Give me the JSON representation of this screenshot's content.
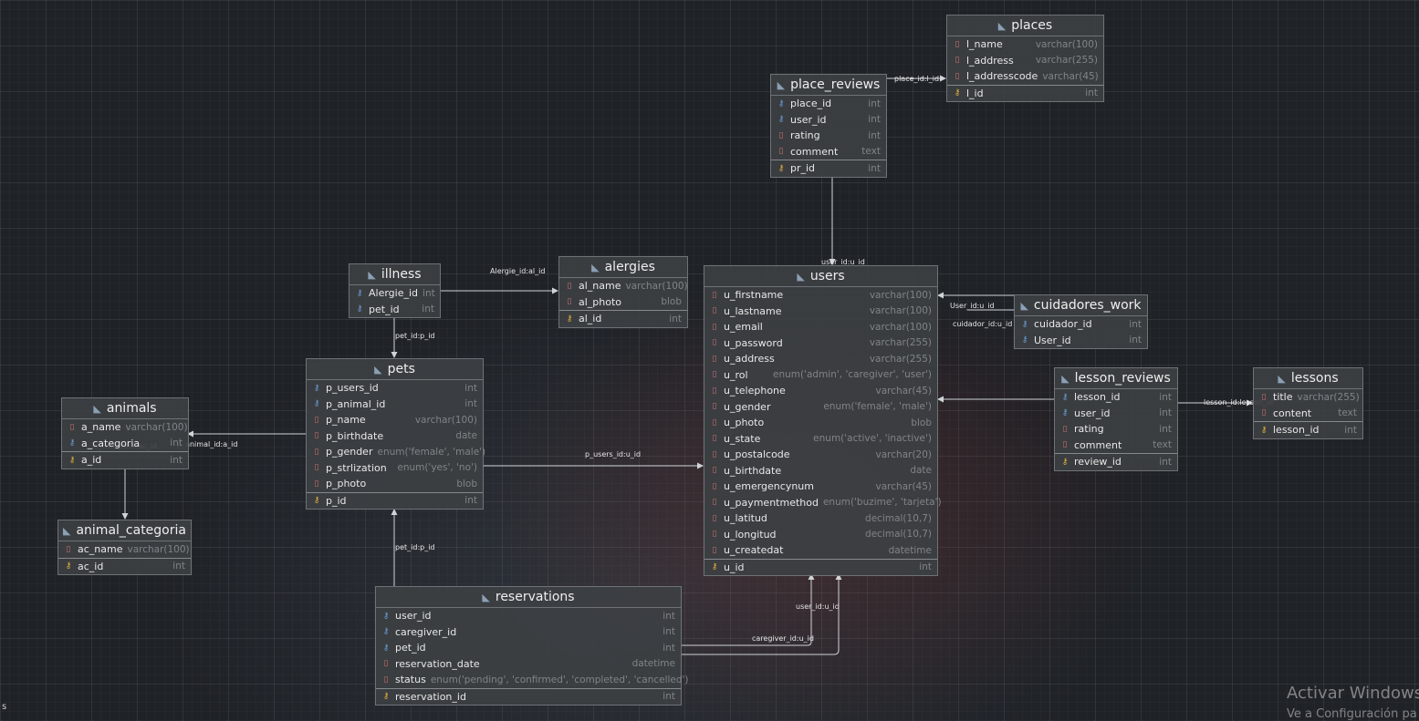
{
  "tables": {
    "places": {
      "name": "places",
      "columns": [
        {
          "name": "l_name",
          "type": "varchar(100)",
          "kind": "field"
        },
        {
          "name": "l_address",
          "type": "varchar(255)",
          "kind": "field"
        },
        {
          "name": "l_addresscode",
          "type": "varchar(45)",
          "kind": "field"
        },
        {
          "name": "l_id",
          "type": "int",
          "kind": "key"
        }
      ]
    },
    "place_reviews": {
      "name": "place_reviews",
      "columns": [
        {
          "name": "place_id",
          "type": "int",
          "kind": "fk"
        },
        {
          "name": "user_id",
          "type": "int",
          "kind": "fk"
        },
        {
          "name": "rating",
          "type": "int",
          "kind": "field"
        },
        {
          "name": "comment",
          "type": "text",
          "kind": "field"
        },
        {
          "name": "pr_id",
          "type": "int",
          "kind": "key"
        }
      ]
    },
    "illness": {
      "name": "illness",
      "columns": [
        {
          "name": "Alergie_id",
          "type": "int",
          "kind": "fk"
        },
        {
          "name": "pet_id",
          "type": "int",
          "kind": "fk"
        }
      ]
    },
    "alergies": {
      "name": "alergies",
      "columns": [
        {
          "name": "al_name",
          "type": "varchar(100)",
          "kind": "field"
        },
        {
          "name": "al_photo",
          "type": "blob",
          "kind": "field"
        },
        {
          "name": "al_id",
          "type": "int",
          "kind": "key"
        }
      ]
    },
    "users": {
      "name": "users",
      "columns": [
        {
          "name": "u_firstname",
          "type": "varchar(100)",
          "kind": "field"
        },
        {
          "name": "u_lastname",
          "type": "varchar(100)",
          "kind": "field"
        },
        {
          "name": "u_email",
          "type": "varchar(100)",
          "kind": "field"
        },
        {
          "name": "u_password",
          "type": "varchar(255)",
          "kind": "field"
        },
        {
          "name": "u_address",
          "type": "varchar(255)",
          "kind": "field"
        },
        {
          "name": "u_rol",
          "type": "enum('admin', 'caregiver', 'user')",
          "kind": "field"
        },
        {
          "name": "u_telephone",
          "type": "varchar(45)",
          "kind": "field"
        },
        {
          "name": "u_gender",
          "type": "enum('female', 'male')",
          "kind": "field"
        },
        {
          "name": "u_photo",
          "type": "blob",
          "kind": "field"
        },
        {
          "name": "u_state",
          "type": "enum('active', 'inactive')",
          "kind": "field"
        },
        {
          "name": "u_postalcode",
          "type": "varchar(20)",
          "kind": "field"
        },
        {
          "name": "u_birthdate",
          "type": "date",
          "kind": "field"
        },
        {
          "name": "u_emergencynum",
          "type": "varchar(45)",
          "kind": "field"
        },
        {
          "name": "u_paymentmethod",
          "type": "enum('buzime', 'tarjeta')",
          "kind": "field"
        },
        {
          "name": "u_latitud",
          "type": "decimal(10,7)",
          "kind": "field"
        },
        {
          "name": "u_longitud",
          "type": "decimal(10,7)",
          "kind": "field"
        },
        {
          "name": "u_createdat",
          "type": "datetime",
          "kind": "field"
        },
        {
          "name": "u_id",
          "type": "int",
          "kind": "key"
        }
      ]
    },
    "cuidadores_work": {
      "name": "cuidadores_work",
      "columns": [
        {
          "name": "cuidador_id",
          "type": "int",
          "kind": "fk"
        },
        {
          "name": "User_id",
          "type": "int",
          "kind": "fk"
        }
      ]
    },
    "pets": {
      "name": "pets",
      "columns": [
        {
          "name": "p_users_id",
          "type": "int",
          "kind": "fk"
        },
        {
          "name": "p_animal_id",
          "type": "int",
          "kind": "fk"
        },
        {
          "name": "p_name",
          "type": "varchar(100)",
          "kind": "field"
        },
        {
          "name": "p_birthdate",
          "type": "date",
          "kind": "field"
        },
        {
          "name": "p_gender",
          "type": "enum('female', 'male')",
          "kind": "field"
        },
        {
          "name": "p_strlization",
          "type": "enum('yes', 'no')",
          "kind": "field"
        },
        {
          "name": "p_photo",
          "type": "blob",
          "kind": "field"
        },
        {
          "name": "p_id",
          "type": "int",
          "kind": "key"
        }
      ]
    },
    "animals": {
      "name": "animals",
      "columns": [
        {
          "name": "a_name",
          "type": "varchar(100)",
          "kind": "field"
        },
        {
          "name": "a_categoria",
          "type": "int",
          "kind": "fk"
        },
        {
          "name": "a_id",
          "type": "int",
          "kind": "key"
        }
      ]
    },
    "animal_categoria": {
      "name": "animal_categoria",
      "columns": [
        {
          "name": "ac_name",
          "type": "varchar(100)",
          "kind": "field"
        },
        {
          "name": "ac_id",
          "type": "int",
          "kind": "key"
        }
      ]
    },
    "lesson_reviews": {
      "name": "lesson_reviews",
      "columns": [
        {
          "name": "lesson_id",
          "type": "int",
          "kind": "fk"
        },
        {
          "name": "user_id",
          "type": "int",
          "kind": "fk"
        },
        {
          "name": "rating",
          "type": "int",
          "kind": "field"
        },
        {
          "name": "comment",
          "type": "text",
          "kind": "field"
        },
        {
          "name": "review_id",
          "type": "int",
          "kind": "key"
        }
      ]
    },
    "lessons": {
      "name": "lessons",
      "columns": [
        {
          "name": "title",
          "type": "varchar(255)",
          "kind": "field"
        },
        {
          "name": "content",
          "type": "text",
          "kind": "field"
        },
        {
          "name": "lesson_id",
          "type": "int",
          "kind": "key"
        }
      ]
    },
    "reservations": {
      "name": "reservations",
      "columns": [
        {
          "name": "user_id",
          "type": "int",
          "kind": "fk"
        },
        {
          "name": "caregiver_id",
          "type": "int",
          "kind": "fk"
        },
        {
          "name": "pet_id",
          "type": "int",
          "kind": "fk"
        },
        {
          "name": "reservation_date",
          "type": "datetime",
          "kind": "field"
        },
        {
          "name": "status",
          "type": "enum('pending', 'confirmed', 'completed', 'cancelled')",
          "kind": "field"
        },
        {
          "name": "reservation_id",
          "type": "int",
          "kind": "key"
        }
      ]
    }
  },
  "relations": {
    "place_reviews_places": "place_id:l_id",
    "place_reviews_users": "user_id:u_id",
    "illness_alergies": "Alergie_id:al_id",
    "illness_pets": "pet_id:p_id",
    "pets_animals": "p_animal_id:a_id",
    "animals_categoria": "a_categoria:ac_id",
    "pets_users": "p_users_id:u_id",
    "cuidadores_user": "User_id:u_id",
    "cuidadores_cuidador": "cuidador_id:u_id",
    "lesson_reviews_users": "user_id:u_id",
    "lesson_reviews_lessons": "lesson_id:lesson_id",
    "reservations_pets": "pet_id:p_id",
    "reservations_user": "user_id:u_id",
    "reservations_caregiver": "caregiver_id:u_id"
  },
  "icons": {
    "table": "table-icon",
    "field": "column-icon",
    "fk": "foreign-key-icon",
    "key": "primary-key-icon"
  },
  "colors": {
    "field_icon": "#c8716e",
    "fk_icon": "#6aa0d8",
    "key_icon": "#e3b33b"
  },
  "watermark": {
    "title": "Activar Windows",
    "subtitle": "Ve a Configuración pa"
  },
  "corner_text": "s"
}
